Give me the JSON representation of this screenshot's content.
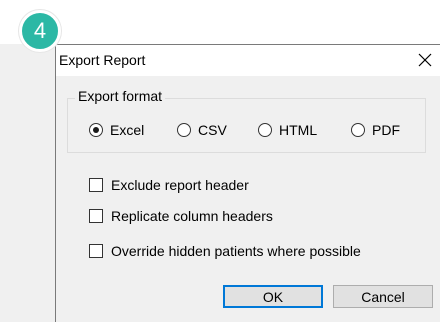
{
  "step_badge": {
    "number": "4",
    "color": "#2cb8a5"
  },
  "dialog": {
    "title": "Export Report",
    "close_icon": "close-icon",
    "export_format": {
      "legend": "Export format",
      "options": [
        {
          "label": "Excel",
          "checked": true
        },
        {
          "label": "CSV",
          "checked": false
        },
        {
          "label": "HTML",
          "checked": false
        },
        {
          "label": "PDF",
          "checked": false
        }
      ]
    },
    "checkboxes": [
      {
        "label": "Exclude report header",
        "checked": false
      },
      {
        "label": "Replicate column headers",
        "checked": false
      },
      {
        "label": "Override hidden patients where possible",
        "checked": false
      }
    ],
    "buttons": {
      "ok": "OK",
      "cancel": "Cancel"
    }
  },
  "colors": {
    "accent": "#0078d7",
    "badge": "#2cb8a5"
  }
}
